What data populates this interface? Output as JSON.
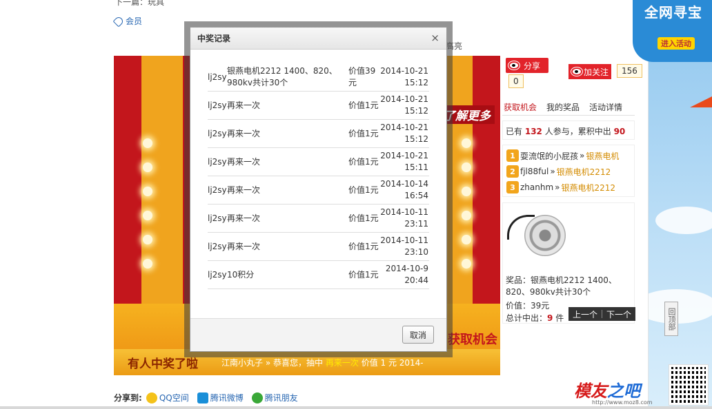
{
  "page": {
    "prev_line": "下一篇：玩具",
    "tag_label": "会员",
    "hiliang": "高亮"
  },
  "banner": {
    "know_more": "了解更多",
    "get_chance": "获取机会",
    "winner_title": "有人中奖了啦",
    "ticker": {
      "user": "江南小丸子 »",
      "congrats": "恭喜您，抽中",
      "prize": "再来一次",
      "value": "价值 1 元  2014-"
    }
  },
  "social": {
    "share_label": "分享",
    "share_count": "0",
    "follow_label": "加关注",
    "follow_count": "156"
  },
  "tabs": [
    {
      "label": "获取机会",
      "active": true
    },
    {
      "label": "我的奖品",
      "active": false
    },
    {
      "label": "活动详情",
      "active": false
    }
  ],
  "stats": {
    "prefix": "已有",
    "participants": "132",
    "middle": "人参与，累积中出",
    "wins": "90"
  },
  "ranking": [
    {
      "rank": "1",
      "user": "耍流氓的小屁孩",
      "arrow": "»",
      "prize": "银燕电机"
    },
    {
      "rank": "2",
      "user": "fjl88ful",
      "arrow": "»",
      "prize": "银燕电机2212"
    },
    {
      "rank": "3",
      "user": "zhanhm",
      "arrow": "»",
      "prize": "银燕电机2212"
    }
  ],
  "prize_card": {
    "desc": "奖品：银燕电机2212 1400、820、980kv共计30个",
    "value": "价值：39元",
    "total_prefix": "总计中出：",
    "total_num": "9",
    "total_unit": "件",
    "prev": "上一个",
    "next": "下一个"
  },
  "back_top": "回顶部",
  "promo": {
    "title": "全网寻宝",
    "btn": "进入活动"
  },
  "logo": {
    "main": "模友",
    "sub": "之吧",
    "url": "http://www.moz8.com"
  },
  "share_bar": {
    "label": "分享到:",
    "items": [
      "QQ空间",
      "腾讯微博",
      "腾讯朋友"
    ]
  },
  "dialog": {
    "title": "中奖记录",
    "close": "×",
    "cancel": "取消",
    "records": [
      {
        "user": "lj2sy",
        "item": "银燕电机2212 1400、820、980kv共计30个",
        "value": "价值39元",
        "date": "2014-10-21",
        "time": "15:12"
      },
      {
        "user": "lj2sy",
        "item": "再来一次",
        "value": "价值1元",
        "date": "2014-10-21",
        "time": "15:12"
      },
      {
        "user": "lj2sy",
        "item": "再来一次",
        "value": "价值1元",
        "date": "2014-10-21",
        "time": "15:12"
      },
      {
        "user": "lj2sy",
        "item": "再来一次",
        "value": "价值1元",
        "date": "2014-10-21",
        "time": "15:11"
      },
      {
        "user": "lj2sy",
        "item": "再来一次",
        "value": "价值1元",
        "date": "2014-10-14",
        "time": "16:54"
      },
      {
        "user": "lj2sy",
        "item": "再来一次",
        "value": "价值1元",
        "date": "2014-10-11",
        "time": "23:11"
      },
      {
        "user": "lj2sy",
        "item": "再来一次",
        "value": "价值1元",
        "date": "2014-10-11",
        "time": "23:10"
      },
      {
        "user": "lj2sy",
        "item": "10积分",
        "value": "价值1元",
        "date": "2014-10-9",
        "time": "20:44"
      }
    ]
  },
  "colors": {
    "accent_red": "#e2232a",
    "link_blue": "#2867b2",
    "prize_orange": "#d38b00"
  }
}
